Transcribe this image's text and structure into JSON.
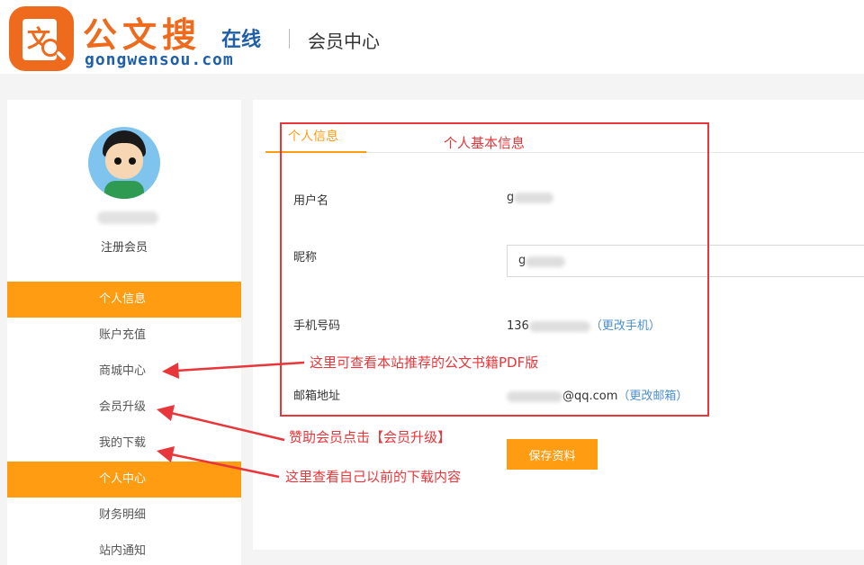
{
  "header": {
    "logo_title": "公文搜",
    "logo_online": "在线",
    "logo_domain": "gongwensou.com",
    "page_title": "会员中心"
  },
  "sidebar": {
    "member_type": "注册会员",
    "items": [
      {
        "label": "个人信息",
        "active": true
      },
      {
        "label": "账户充值"
      },
      {
        "label": "商城中心"
      },
      {
        "label": "会员升级"
      },
      {
        "label": "我的下载"
      },
      {
        "label": "个人中心",
        "section": true
      },
      {
        "label": "财务明细"
      },
      {
        "label": "站内通知"
      }
    ]
  },
  "main": {
    "tab_label": "个人信息",
    "fields": {
      "username_label": "用户名",
      "username_value": "g",
      "nickname_label": "昵称",
      "nickname_value": "g",
      "phone_label": "手机号码",
      "phone_value": "136",
      "phone_change": "（更改手机）",
      "email_label": "邮箱地址",
      "email_value": "@qq.com",
      "email_change": "（更改邮箱）"
    },
    "save_label": "保存资料"
  },
  "annotations": {
    "basic_info": "个人基本信息",
    "mall": "这里可查看本站推荐的公文书籍PDF版",
    "upgrade": "赞助会员点击【会员升级】",
    "downloads": "这里查看自己以前的下载内容"
  },
  "colors": {
    "accent": "#ff9c12",
    "brand_orange": "#ee6b1d",
    "brand_blue": "#1e5fa8",
    "annotation_red": "#e8363a",
    "link": "#4a8ed1"
  }
}
